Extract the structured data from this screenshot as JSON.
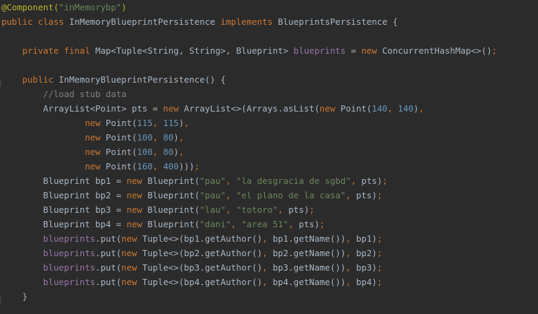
{
  "theme": {
    "background": "#2b2b2b",
    "default": "#a9b7c6",
    "keyword": "#cc7832",
    "annotation": "#bbb529",
    "string": "#6a8759",
    "number": "#6897bb",
    "comment": "#808080",
    "field": "#9876aa"
  },
  "code_lines": [
    [
      [
        "@Component(",
        "annotation"
      ],
      [
        "\"inMemorybp\"",
        "string"
      ],
      [
        ")",
        "annotation"
      ]
    ],
    [
      [
        "public class ",
        "keyword"
      ],
      [
        "InMemoryBlueprintPersistence ",
        "default"
      ],
      [
        "implements ",
        "keyword"
      ],
      [
        "BlueprintsPersistence {",
        "default"
      ]
    ],
    [],
    [
      [
        "    ",
        "default"
      ],
      [
        "private final ",
        "keyword"
      ],
      [
        "Map<Tuple<String, String>, Blueprint> ",
        "default"
      ],
      [
        "blueprints",
        "field"
      ],
      [
        " = ",
        "default"
      ],
      [
        "new ",
        "keyword"
      ],
      [
        "ConcurrentHashMap<>()",
        "default"
      ],
      [
        ";",
        "keyword"
      ]
    ],
    [],
    [
      [
        "    ",
        "default"
      ],
      [
        "public ",
        "keyword"
      ],
      [
        "InMemoryBlueprintPersistence() {",
        "default"
      ]
    ],
    [
      [
        "        ",
        "default"
      ],
      [
        "//load stub data",
        "comment"
      ]
    ],
    [
      [
        "        ArrayList<Point> pts = ",
        "default"
      ],
      [
        "new ",
        "keyword"
      ],
      [
        "ArrayList<>(Arrays.asList(",
        "default"
      ],
      [
        "new ",
        "keyword"
      ],
      [
        "Point(",
        "default"
      ],
      [
        "140",
        "number"
      ],
      [
        ", ",
        "keyword"
      ],
      [
        "140",
        "number"
      ],
      [
        ")",
        "default"
      ],
      [
        ",",
        "keyword"
      ]
    ],
    [
      [
        "                ",
        "default"
      ],
      [
        "new ",
        "keyword"
      ],
      [
        "Point(",
        "default"
      ],
      [
        "115",
        "number"
      ],
      [
        ", ",
        "keyword"
      ],
      [
        "115",
        "number"
      ],
      [
        ")",
        "default"
      ],
      [
        ",",
        "keyword"
      ]
    ],
    [
      [
        "                ",
        "default"
      ],
      [
        "new ",
        "keyword"
      ],
      [
        "Point(",
        "default"
      ],
      [
        "100",
        "number"
      ],
      [
        ", ",
        "keyword"
      ],
      [
        "80",
        "number"
      ],
      [
        ")",
        "default"
      ],
      [
        ",",
        "keyword"
      ]
    ],
    [
      [
        "                ",
        "default"
      ],
      [
        "new ",
        "keyword"
      ],
      [
        "Point(",
        "default"
      ],
      [
        "100",
        "number"
      ],
      [
        ", ",
        "keyword"
      ],
      [
        "80",
        "number"
      ],
      [
        ")",
        "default"
      ],
      [
        ",",
        "keyword"
      ]
    ],
    [
      [
        "                ",
        "default"
      ],
      [
        "new ",
        "keyword"
      ],
      [
        "Point(",
        "default"
      ],
      [
        "160",
        "number"
      ],
      [
        ", ",
        "keyword"
      ],
      [
        "400",
        "number"
      ],
      [
        ")))",
        "default"
      ],
      [
        ";",
        "keyword"
      ]
    ],
    [
      [
        "        Blueprint bp1 = ",
        "default"
      ],
      [
        "new ",
        "keyword"
      ],
      [
        "Blueprint(",
        "default"
      ],
      [
        "\"pau\"",
        "string"
      ],
      [
        ", ",
        "keyword"
      ],
      [
        "\"la desgracia de sgbd\"",
        "string"
      ],
      [
        ", ",
        "keyword"
      ],
      [
        "pts)",
        "default"
      ],
      [
        ";",
        "keyword"
      ]
    ],
    [
      [
        "        Blueprint bp2 = ",
        "default"
      ],
      [
        "new ",
        "keyword"
      ],
      [
        "Blueprint(",
        "default"
      ],
      [
        "\"pau\"",
        "string"
      ],
      [
        ", ",
        "keyword"
      ],
      [
        "\"el plano de la casa\"",
        "string"
      ],
      [
        ", ",
        "keyword"
      ],
      [
        "pts)",
        "default"
      ],
      [
        ";",
        "keyword"
      ]
    ],
    [
      [
        "        Blueprint bp3 = ",
        "default"
      ],
      [
        "new ",
        "keyword"
      ],
      [
        "Blueprint(",
        "default"
      ],
      [
        "\"lau\"",
        "string"
      ],
      [
        ", ",
        "keyword"
      ],
      [
        "\"totoro\"",
        "string"
      ],
      [
        ", ",
        "keyword"
      ],
      [
        "pts)",
        "default"
      ],
      [
        ";",
        "keyword"
      ]
    ],
    [
      [
        "        Blueprint bp4 = ",
        "default"
      ],
      [
        "new ",
        "keyword"
      ],
      [
        "Blueprint(",
        "default"
      ],
      [
        "\"dani\"",
        "string"
      ],
      [
        ", ",
        "keyword"
      ],
      [
        "\"area 51\"",
        "string"
      ],
      [
        ", ",
        "keyword"
      ],
      [
        "pts)",
        "default"
      ],
      [
        ";",
        "keyword"
      ]
    ],
    [
      [
        "        ",
        "default"
      ],
      [
        "blueprints",
        "field"
      ],
      [
        ".put(",
        "default"
      ],
      [
        "new ",
        "keyword"
      ],
      [
        "Tuple<>(bp1.getAuthor()",
        "default"
      ],
      [
        ", ",
        "keyword"
      ],
      [
        "bp1.getName())",
        "default"
      ],
      [
        ", ",
        "keyword"
      ],
      [
        "bp1)",
        "default"
      ],
      [
        ";",
        "keyword"
      ]
    ],
    [
      [
        "        ",
        "default"
      ],
      [
        "blueprints",
        "field"
      ],
      [
        ".put(",
        "default"
      ],
      [
        "new ",
        "keyword"
      ],
      [
        "Tuple<>(bp2.getAuthor()",
        "default"
      ],
      [
        ", ",
        "keyword"
      ],
      [
        "bp2.getName())",
        "default"
      ],
      [
        ", ",
        "keyword"
      ],
      [
        "bp2)",
        "default"
      ],
      [
        ";",
        "keyword"
      ]
    ],
    [
      [
        "        ",
        "default"
      ],
      [
        "blueprints",
        "field"
      ],
      [
        ".put(",
        "default"
      ],
      [
        "new ",
        "keyword"
      ],
      [
        "Tuple<>(bp3.getAuthor()",
        "default"
      ],
      [
        ", ",
        "keyword"
      ],
      [
        "bp3.getName())",
        "default"
      ],
      [
        ", ",
        "keyword"
      ],
      [
        "bp3)",
        "default"
      ],
      [
        ";",
        "keyword"
      ]
    ],
    [
      [
        "        ",
        "default"
      ],
      [
        "blueprints",
        "field"
      ],
      [
        ".put(",
        "default"
      ],
      [
        "new ",
        "keyword"
      ],
      [
        "Tuple<>(bp4.getAuthor()",
        "default"
      ],
      [
        ", ",
        "keyword"
      ],
      [
        "bp4.getName())",
        "default"
      ],
      [
        ", ",
        "keyword"
      ],
      [
        "bp4)",
        "default"
      ],
      [
        ";",
        "keyword"
      ]
    ],
    [
      [
        "    }",
        "default"
      ]
    ]
  ]
}
